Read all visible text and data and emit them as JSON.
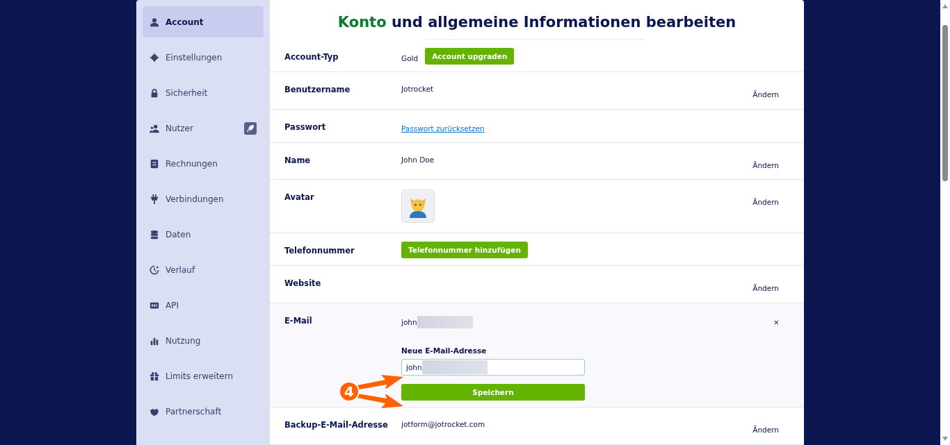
{
  "sidebar": {
    "items": [
      {
        "label": "Account",
        "selected": true,
        "badge": false
      },
      {
        "label": "Einstellungen",
        "selected": false,
        "badge": false
      },
      {
        "label": "Sicherheit",
        "selected": false,
        "badge": false
      },
      {
        "label": "Nutzer",
        "selected": false,
        "badge": true
      },
      {
        "label": "Rechnungen",
        "selected": false,
        "badge": false
      },
      {
        "label": "Verbindungen",
        "selected": false,
        "badge": false
      },
      {
        "label": "Daten",
        "selected": false,
        "badge": false
      },
      {
        "label": "Verlauf",
        "selected": false,
        "badge": false
      },
      {
        "label": "API",
        "selected": false,
        "badge": false
      },
      {
        "label": "Nutzung",
        "selected": false,
        "badge": false
      },
      {
        "label": "Limits erweitern",
        "selected": false,
        "badge": false
      },
      {
        "label": "Partnerschaft",
        "selected": false,
        "badge": false
      }
    ]
  },
  "title": {
    "highlight": "Konto",
    "rest": "und allgemeine Informationen bearbeiten"
  },
  "rows": [
    {
      "kind": "button",
      "label": "Account-Typ",
      "value": "Gold",
      "button": "Account upgraden"
    },
    {
      "kind": "text",
      "label": "Benutzername",
      "value": "Jotrocket",
      "action": "Ändern"
    },
    {
      "kind": "link",
      "label": "Passwort",
      "value": "Passwort zurücksetzen"
    },
    {
      "kind": "text",
      "label": "Name",
      "value": "John Doe",
      "action": "Ändern"
    },
    {
      "kind": "avatar",
      "label": "Avatar",
      "action": "Ändern"
    },
    {
      "kind": "button",
      "label": "Telefonnummer",
      "button": "Telefonnummer hinzufügen"
    },
    {
      "kind": "text",
      "label": "Website",
      "action": "Ändern"
    },
    {
      "kind": "email_edit",
      "label": "E-Mail",
      "value": "john",
      "close": "×",
      "field_label": "Neue E-Mail-Adresse",
      "field_value": "john",
      "button": "Speichern"
    },
    {
      "kind": "text",
      "label": "Backup-E-Mail-Adresse",
      "value": "jotform@jotrocket.com",
      "action": "Ändern"
    }
  ],
  "annotation": {
    "number": "4"
  }
}
